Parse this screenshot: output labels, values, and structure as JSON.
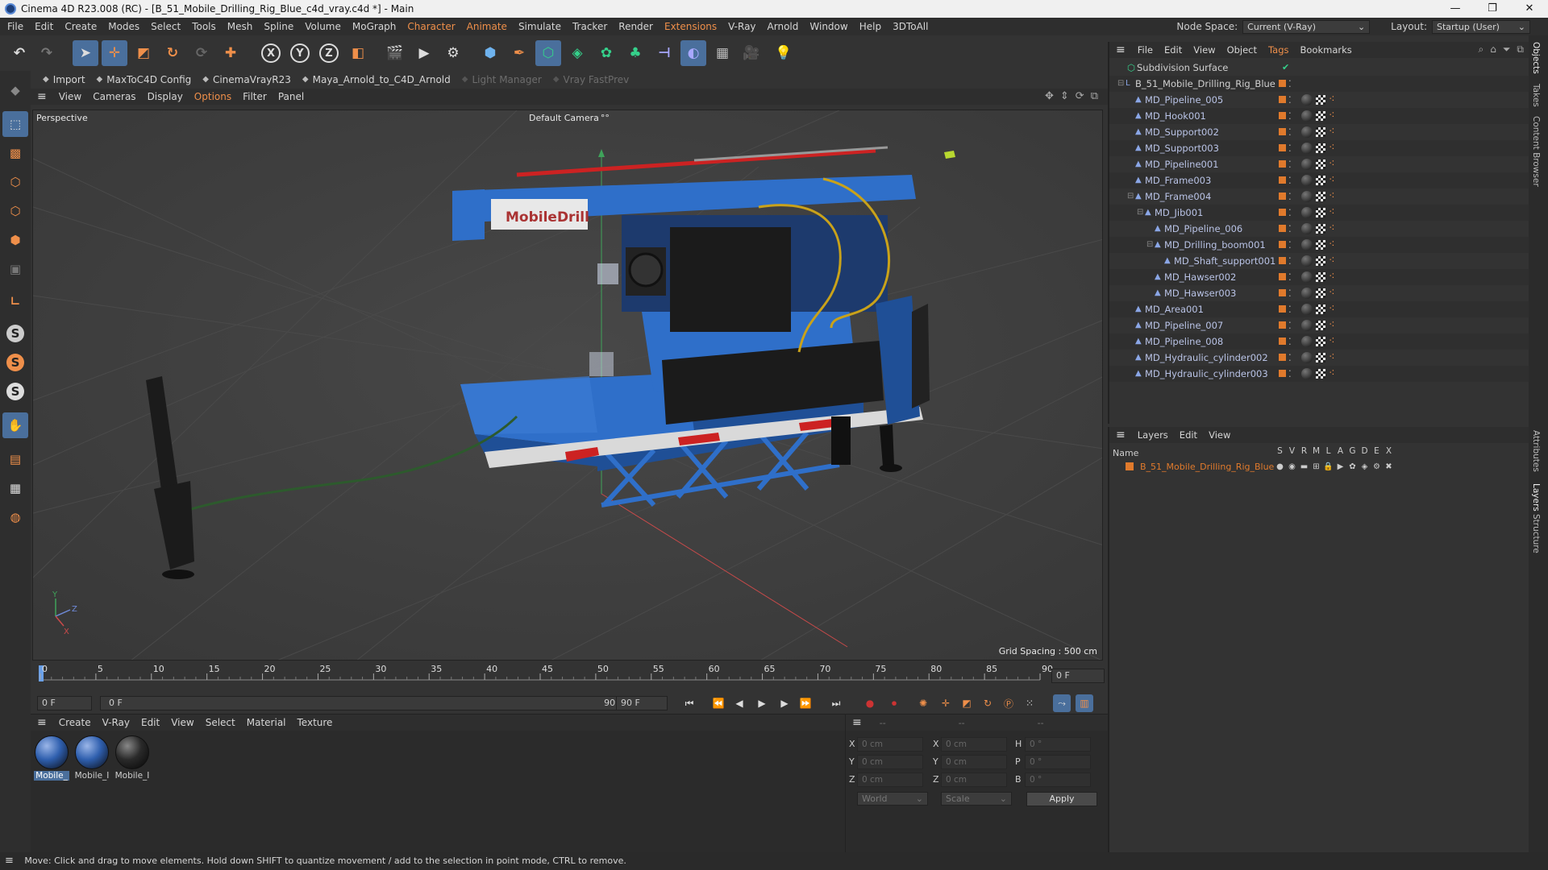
{
  "window": {
    "title": "Cinema 4D R23.008 (RC) - [B_51_Mobile_Drilling_Rig_Blue_c4d_vray.c4d *] - Main",
    "minimize": "—",
    "restore": "❐",
    "close": "✕"
  },
  "menu": {
    "items": [
      "File",
      "Edit",
      "Create",
      "Modes",
      "Select",
      "Tools",
      "Mesh",
      "Spline",
      "Volume",
      "MoGraph",
      "Character",
      "Animate",
      "Simulate",
      "Tracker",
      "Render",
      "Extensions",
      "V-Ray",
      "Arnold",
      "Window",
      "Help",
      "3DToAll"
    ],
    "highlighted": [
      "Character",
      "Animate",
      "Extensions"
    ],
    "node_space_label": "Node Space:",
    "node_space_value": "Current (V-Ray)",
    "layout_label": "Layout:",
    "layout_value": "Startup (User)"
  },
  "toolbar": {
    "icons": [
      "undo-icon",
      "redo-icon",
      "select-arrow-icon",
      "move-icon",
      "scale-icon",
      "rotate-icon",
      "create-object-icon",
      "add-icon",
      "x-axis-icon",
      "y-axis-icon",
      "z-axis-icon",
      "world-coords-icon",
      "render-region-icon",
      "render-view-icon",
      "render-settings-icon",
      "cube-icon",
      "pen-icon",
      "subdivision-icon",
      "array-icon",
      "cloner-icon",
      "generator-icon",
      "deformer-icon",
      "field-icon",
      "floor-icon",
      "camera-icon",
      "light-icon"
    ],
    "axis_labels": [
      "X",
      "Y",
      "Z"
    ]
  },
  "plugins": {
    "items": [
      {
        "label": "Import",
        "dim": false
      },
      {
        "label": "MaxToC4D Config",
        "dim": false
      },
      {
        "label": "CinemaVrayR23",
        "dim": false
      },
      {
        "label": "Maya_Arnold_to_C4D_Arnold",
        "dim": false
      },
      {
        "label": "Light Manager",
        "dim": true
      },
      {
        "label": "Vray FastPrev",
        "dim": true
      }
    ]
  },
  "viewport": {
    "menu": [
      "View",
      "Cameras",
      "Display",
      "Options",
      "Filter",
      "Panel"
    ],
    "highlighted_menu": "Options",
    "projection": "Perspective",
    "camera": "Default Camera",
    "camera_suffix": "°°",
    "grid_spacing": "Grid Spacing : 500 cm",
    "sign_text": "MobileDrill",
    "axis_x": "X",
    "axis_y": "Y",
    "axis_z": "Z",
    "colors": {
      "rig": "#2f6fc9",
      "rig_dark": "#1f4f96",
      "machine": "#1b1b1b",
      "hose": "#c9a21a",
      "bg": "#3e3e3e"
    }
  },
  "timeline": {
    "ticks": [
      "0",
      "5",
      "10",
      "15",
      "20",
      "25",
      "30",
      "35",
      "40",
      "45",
      "50",
      "55",
      "60",
      "65",
      "70",
      "75",
      "80",
      "85",
      "90"
    ],
    "current_frame": "0 F",
    "start_field": "0 F",
    "range_start": "0 F",
    "range_end": "90 F",
    "end_field": "90 F",
    "progress": 0
  },
  "transport": {
    "buttons": [
      "go-start-icon",
      "prev-key-icon",
      "prev-frame-icon",
      "play-icon",
      "next-frame-icon",
      "next-key-icon",
      "go-end-icon",
      "record-icon",
      "autokey-icon",
      "keyframe-selection-icon",
      "move-key-icon",
      "scale-key-icon",
      "rotate-key-icon",
      "param-key-icon",
      "pla-key-icon",
      "grid-dots-icon",
      "motion-icon",
      "timeline-icon"
    ]
  },
  "materials": {
    "menu": [
      "Create",
      "V-Ray",
      "Edit",
      "View",
      "Select",
      "Material",
      "Texture"
    ],
    "items": [
      {
        "label": "Mobile_",
        "selected": true
      },
      {
        "label": "Mobile_I",
        "selected": false
      },
      {
        "label": "Mobile_I",
        "selected": false
      }
    ]
  },
  "coords": {
    "header_dashes": [
      "--",
      "--",
      "--"
    ],
    "rows": [
      {
        "a": "X",
        "av": "0 cm",
        "b": "X",
        "bv": "0 cm",
        "c": "H",
        "cv": "0 °"
      },
      {
        "a": "Y",
        "av": "0 cm",
        "b": "Y",
        "bv": "0 cm",
        "c": "P",
        "cv": "0 °"
      },
      {
        "a": "Z",
        "av": "0 cm",
        "b": "Z",
        "bv": "0 cm",
        "c": "B",
        "cv": "0 °"
      }
    ],
    "mode": "World",
    "transform": "Scale",
    "apply": "Apply"
  },
  "object_manager": {
    "menu": [
      "File",
      "Edit",
      "View",
      "Object",
      "Tags",
      "Bookmarks"
    ],
    "highlighted_menu": "Tags",
    "root": "Subdivision Surface",
    "rows": [
      {
        "name": "B_51_Mobile_Drilling_Rig_Blue",
        "depth": 1,
        "tags": false
      },
      {
        "name": "MD_Pipeline_005",
        "depth": 2,
        "tags": true
      },
      {
        "name": "MD_Hook001",
        "depth": 2,
        "tags": true
      },
      {
        "name": "MD_Support002",
        "depth": 2,
        "tags": true
      },
      {
        "name": "MD_Support003",
        "depth": 2,
        "tags": true
      },
      {
        "name": "MD_Pipeline001",
        "depth": 2,
        "tags": true
      },
      {
        "name": "MD_Frame003",
        "depth": 2,
        "tags": true
      },
      {
        "name": "MD_Frame004",
        "depth": 2,
        "tags": true
      },
      {
        "name": "MD_Jib001",
        "depth": 3,
        "tags": true
      },
      {
        "name": "MD_Pipeline_006",
        "depth": 4,
        "tags": true
      },
      {
        "name": "MD_Drilling_boom001",
        "depth": 4,
        "tags": true
      },
      {
        "name": "MD_Shaft_support001",
        "depth": 5,
        "tags": true
      },
      {
        "name": "MD_Hawser002",
        "depth": 4,
        "tags": true
      },
      {
        "name": "MD_Hawser003",
        "depth": 4,
        "tags": true
      },
      {
        "name": "MD_Area001",
        "depth": 2,
        "tags": true
      },
      {
        "name": "MD_Pipeline_007",
        "depth": 2,
        "tags": true
      },
      {
        "name": "MD_Pipeline_008",
        "depth": 2,
        "tags": true
      },
      {
        "name": "MD_Hydraulic_cylinder002",
        "depth": 2,
        "tags": true
      },
      {
        "name": "MD_Hydraulic_cylinder003",
        "depth": 2,
        "tags": true
      }
    ]
  },
  "layers": {
    "menu": [
      "Layers",
      "Edit",
      "View"
    ],
    "name_header": "Name",
    "columns": [
      "S",
      "V",
      "R",
      "M",
      "L",
      "A",
      "G",
      "D",
      "E",
      "X"
    ],
    "rows": [
      {
        "name": "B_51_Mobile_Drilling_Rig_Blue",
        "color": "#e07a2c"
      }
    ]
  },
  "right_tabs": [
    "Objects",
    "Takes",
    "Content Browser",
    "Attributes",
    "Layers",
    "Structure"
  ],
  "status": "Move: Click and drag to move elements. Hold down SHIFT to quantize movement / add to the selection in point mode, CTRL to remove."
}
